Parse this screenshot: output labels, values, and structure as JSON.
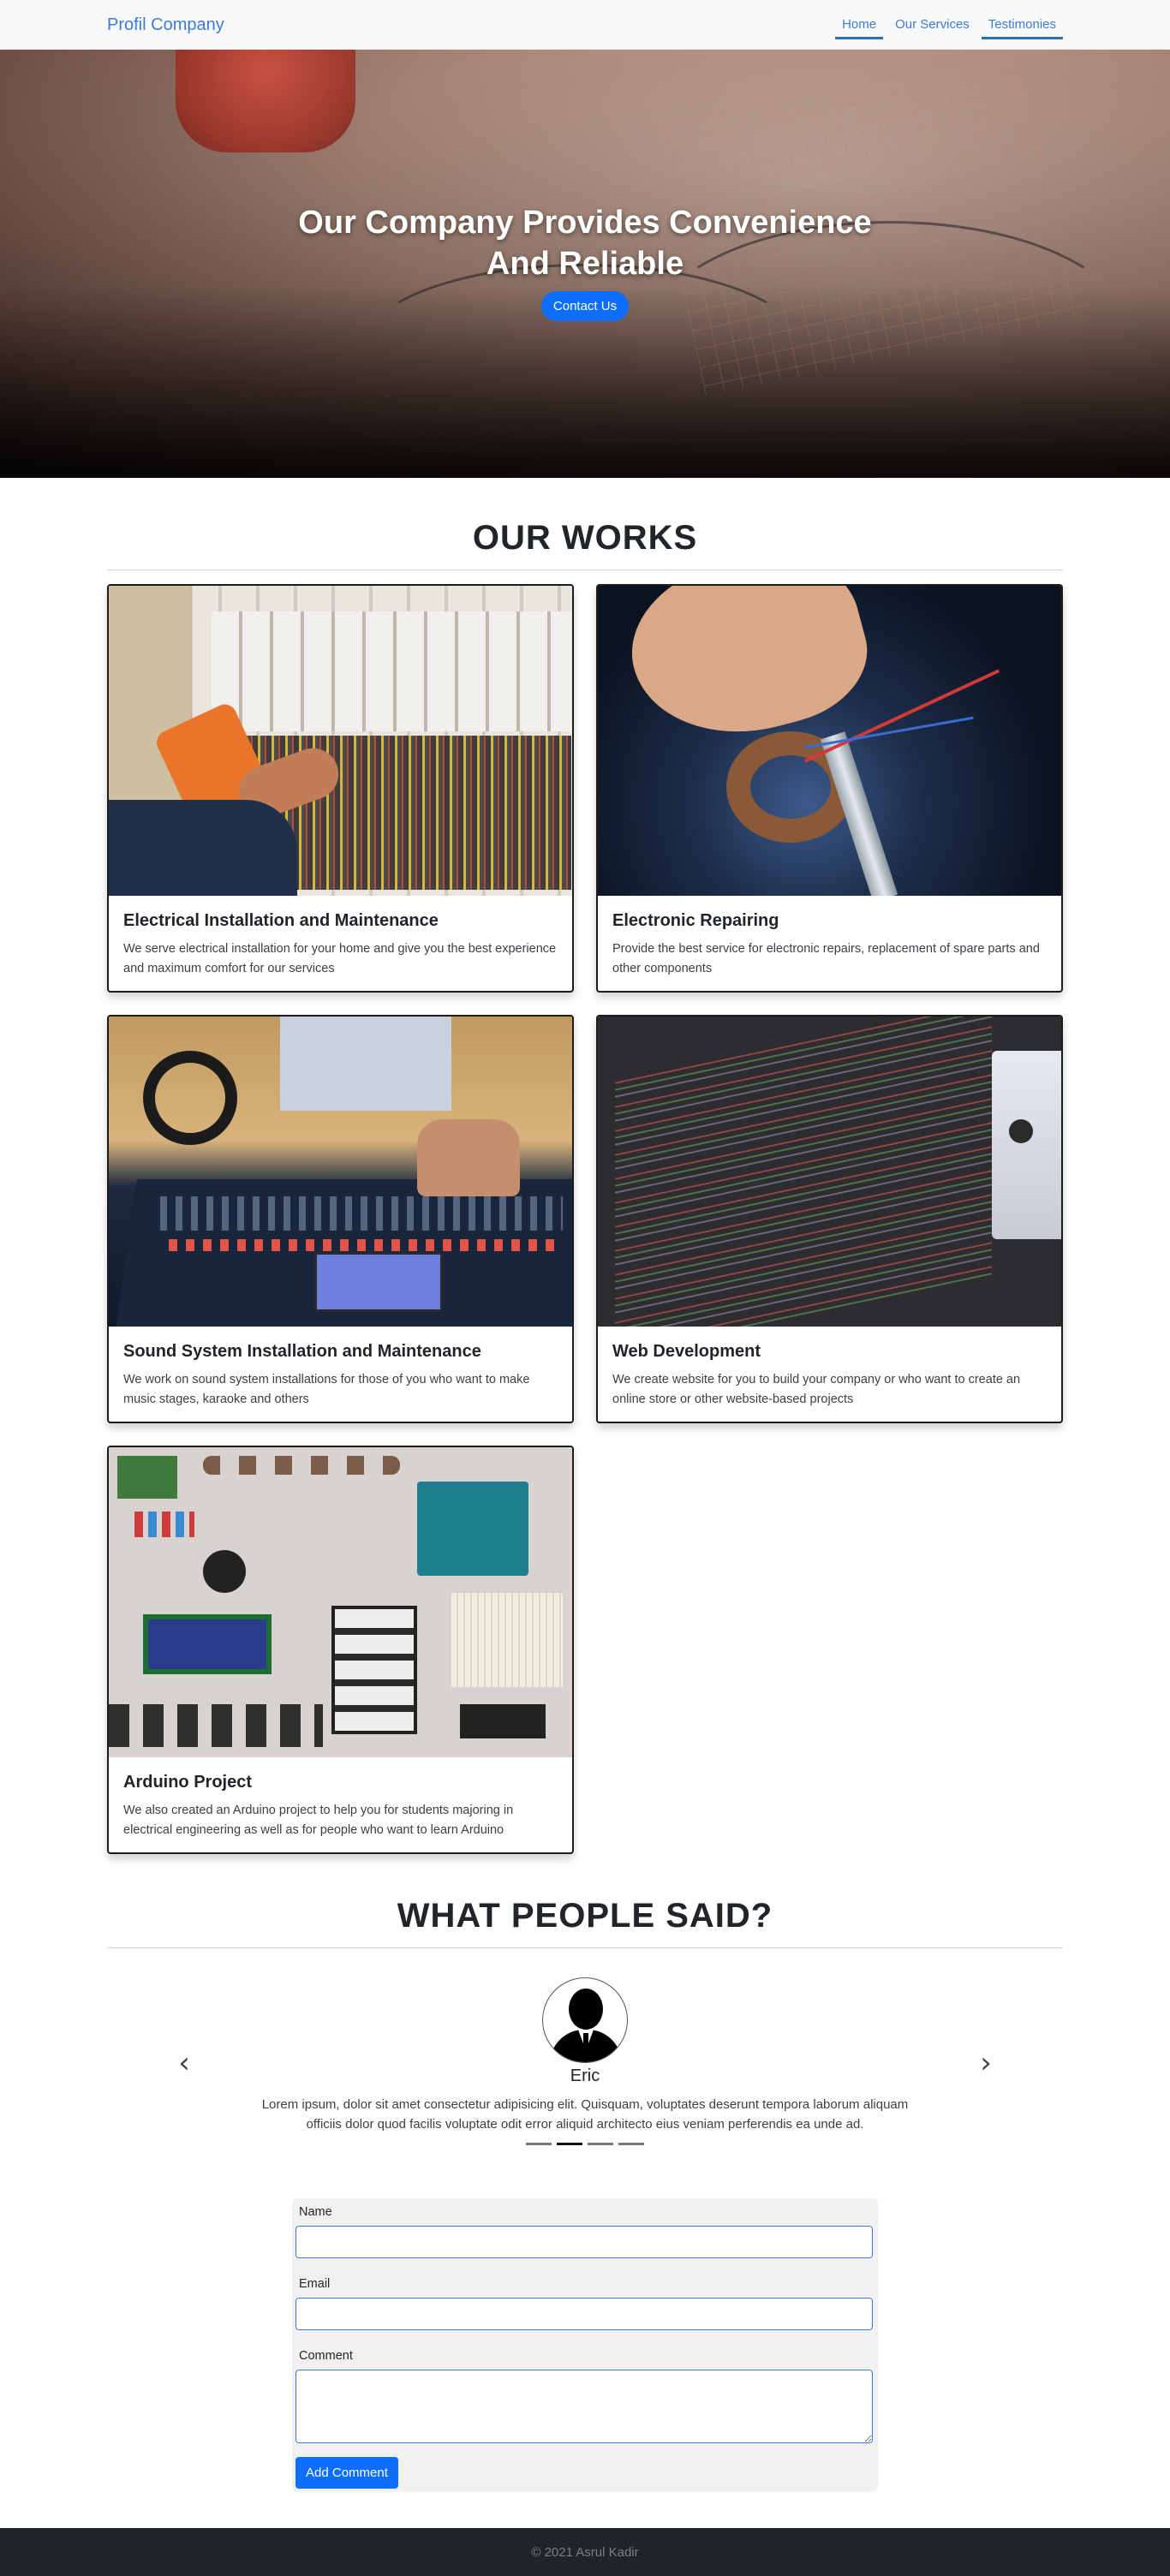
{
  "navbar": {
    "brand": "Profil Company",
    "links": [
      "Home",
      "Our Services",
      "Testimonies"
    ]
  },
  "hero": {
    "title": "Our Company Provides Convenience And Reliable",
    "button": "Contact Us"
  },
  "works": {
    "title": "OUR WORKS",
    "cards": [
      {
        "title": "Electrical Installation and Maintenance",
        "text": "We serve electrical installation for your home and give you the best experience and maximum comfort for our services"
      },
      {
        "title": "Electronic Repairing",
        "text": "Provide the best service for electronic repairs, replacement of spare parts and other components"
      },
      {
        "title": "Sound System Installation and Maintenance",
        "text": "We work on sound system installations for those of you who want to make music stages, karaoke and others"
      },
      {
        "title": "Web Development",
        "text": "We create website for you to build your company or who want to create an online store or other website-based projects"
      },
      {
        "title": "Arduino Project",
        "text": "We also created an Arduino project to help you for students majoring in electrical engineering as well as for people who want to learn Arduino"
      }
    ]
  },
  "testimonies": {
    "title": "WHAT PEOPLE SAID?",
    "name": "Eric",
    "text": "Lorem ipsum, dolor sit amet consectetur adipisicing elit. Quisquam, voluptates deserunt tempora laborum aliquam officiis dolor quod facilis voluptate odit error aliquid architecto eius veniam perferendis ea unde ad.",
    "prev_icon": "chevron-left",
    "next_icon": "chevron-right"
  },
  "form": {
    "name_label": "Name",
    "email_label": "Email",
    "comment_label": "Comment",
    "submit": "Add Comment"
  },
  "footer": {
    "text": "© 2021 Asrul Kadir"
  }
}
